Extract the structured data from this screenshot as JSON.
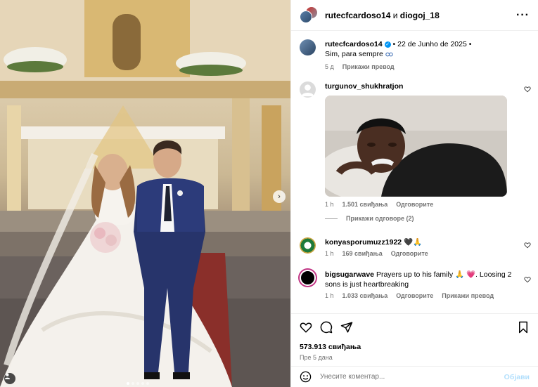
{
  "post": {
    "header_user1": "rutecfcardoso14",
    "header_and": "и",
    "header_user2": "diogoj_18"
  },
  "caption": {
    "username": "rutecfcardoso14",
    "date": "• 22 de Junho de 2025 •",
    "text": "Sim, para sempre",
    "age": "5 д",
    "translate": "Прикажи превод"
  },
  "comments": [
    {
      "username": "turgunov_shukhratjon",
      "text": "",
      "age": "1 h",
      "likes": "1.501 свиђања",
      "reply": "Одговорите",
      "show_replies": "Прикажи одговоре (2)"
    },
    {
      "username": "konyasporumuzz1922",
      "text": "🖤🙏",
      "age": "1 h",
      "likes": "169 свиђања",
      "reply": "Одговорите"
    },
    {
      "username": "bigsugarwave",
      "text": "Prayers up to his family 🙏 💗. Loosing 2 sons is just heartbreaking",
      "age": "1 h",
      "likes": "1.033 свиђања",
      "reply": "Одговорите",
      "translate": "Прикажи превод"
    }
  ],
  "footer": {
    "likes": "573.913 свиђања",
    "time": "Пре 5 дана",
    "comment_placeholder": "Унесите коментар...",
    "post_label": "Објави"
  },
  "icons": {
    "more": "more-icon",
    "heart": "heart-icon",
    "comment": "comment-icon",
    "share": "share-icon",
    "bookmark": "bookmark-icon",
    "emoji": "emoji-icon",
    "next": "chevron-right-icon",
    "tag": "user-tag-icon",
    "link": "link-icon"
  },
  "colors": {
    "verified": "#0095f6",
    "post_button": "#b2dffc",
    "secondary_text": "#737373"
  }
}
